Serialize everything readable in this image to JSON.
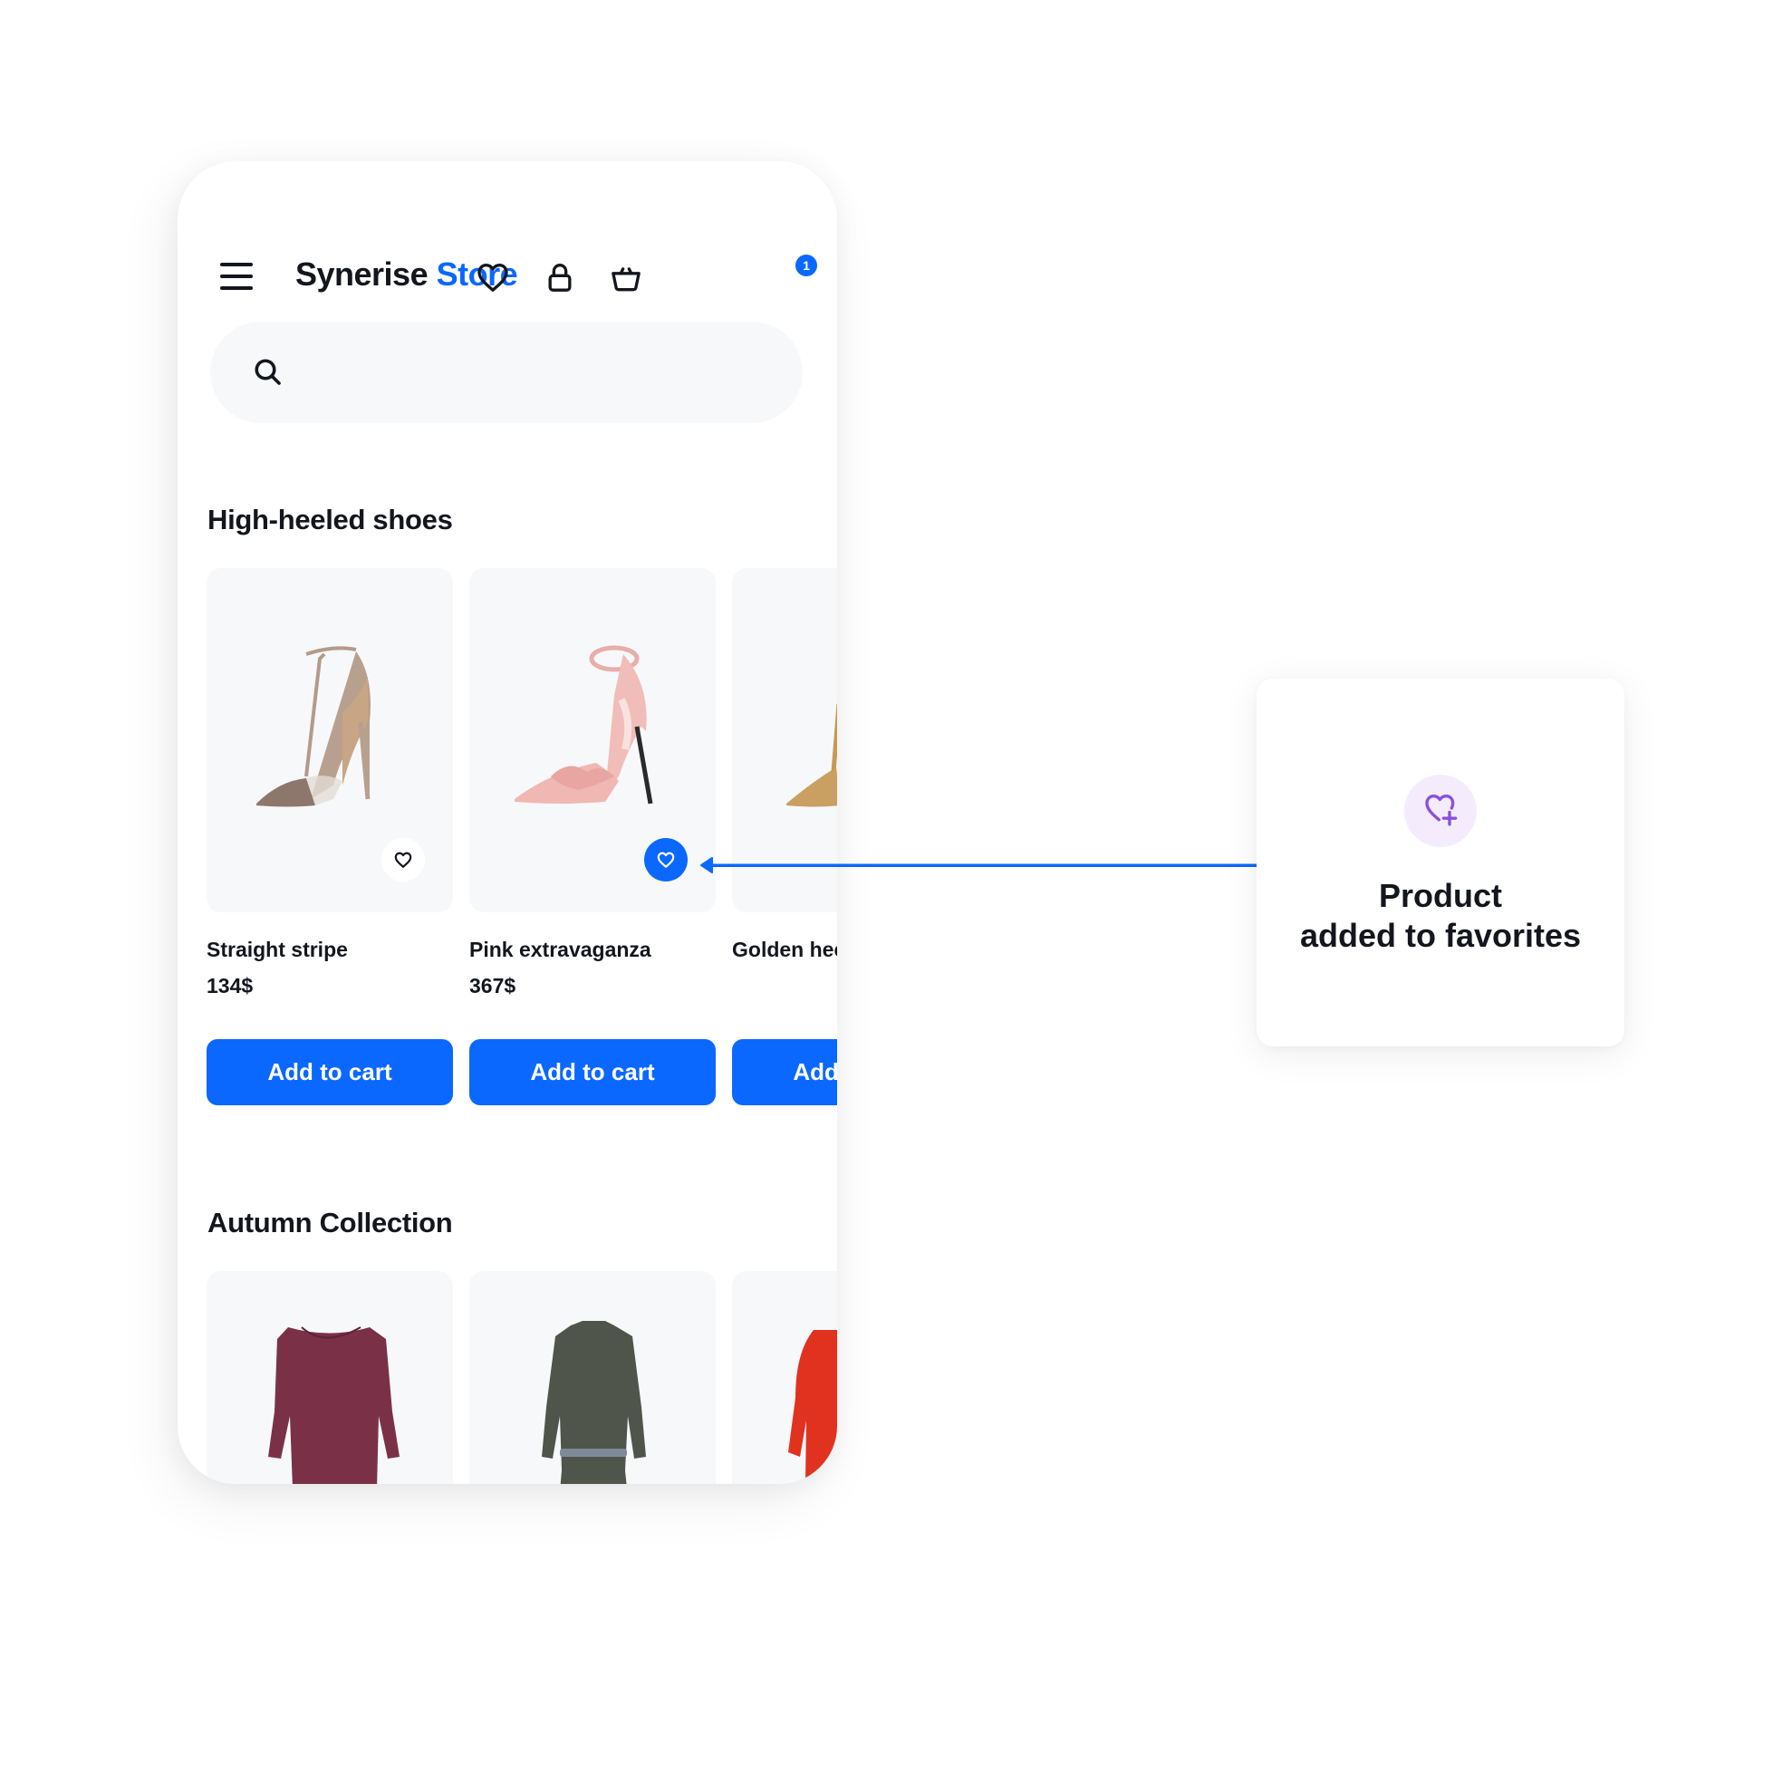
{
  "header": {
    "brand_primary": "Synerise",
    "brand_accent": "Store",
    "cart_count": "1"
  },
  "search": {
    "value": "",
    "placeholder": ""
  },
  "sections": [
    {
      "title": "High-heeled shoes",
      "products": [
        {
          "name": "Straight stripe",
          "price": "134$",
          "button": "Add to cart",
          "favorite": false,
          "image": "nude-t-strap-heel"
        },
        {
          "name": "Pink extravaganza",
          "price": "367$",
          "button": "Add to cart",
          "favorite": true,
          "image": "pink-ruffle-heel"
        },
        {
          "name": "Golden heels",
          "price": "",
          "button": "Add to cart",
          "favorite": false,
          "image": "gold-heel"
        }
      ]
    },
    {
      "title": "Autumn Collection",
      "products": [
        {
          "image": "burgundy-dress"
        },
        {
          "image": "grey-belted-dress"
        },
        {
          "image": "red-dress"
        }
      ]
    }
  ],
  "toast": {
    "icon": "heart-plus-icon",
    "line1": "Product",
    "line2": "added to favorites"
  },
  "colors": {
    "accent": "#0b68ff",
    "text": "#13171d",
    "card_bg": "#f7f8fa",
    "toast_icon": "#8a4fe0",
    "toast_icon_bg": "#f4ecfd"
  }
}
